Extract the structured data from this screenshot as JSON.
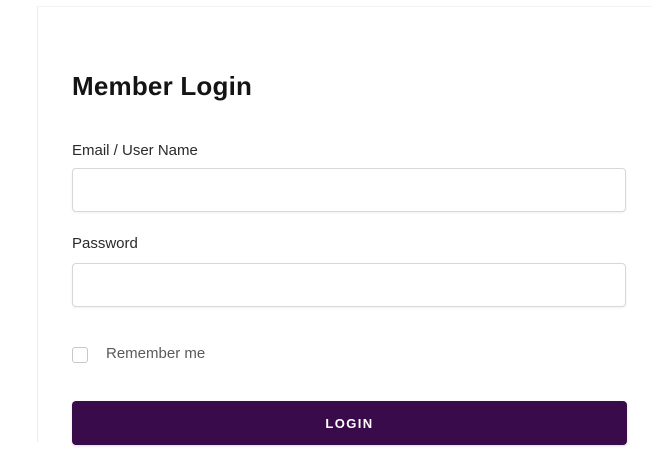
{
  "colors": {
    "accent": "#3a0b4a",
    "button_text": "#ffffff"
  },
  "login_form": {
    "title": "Member Login",
    "email": {
      "label": "Email / User Name",
      "value": "",
      "placeholder": ""
    },
    "password": {
      "label": "Password",
      "value": "",
      "placeholder": ""
    },
    "remember_me": {
      "label": "Remember me",
      "checked": false
    },
    "login_button": {
      "label": "LOGIN"
    }
  }
}
